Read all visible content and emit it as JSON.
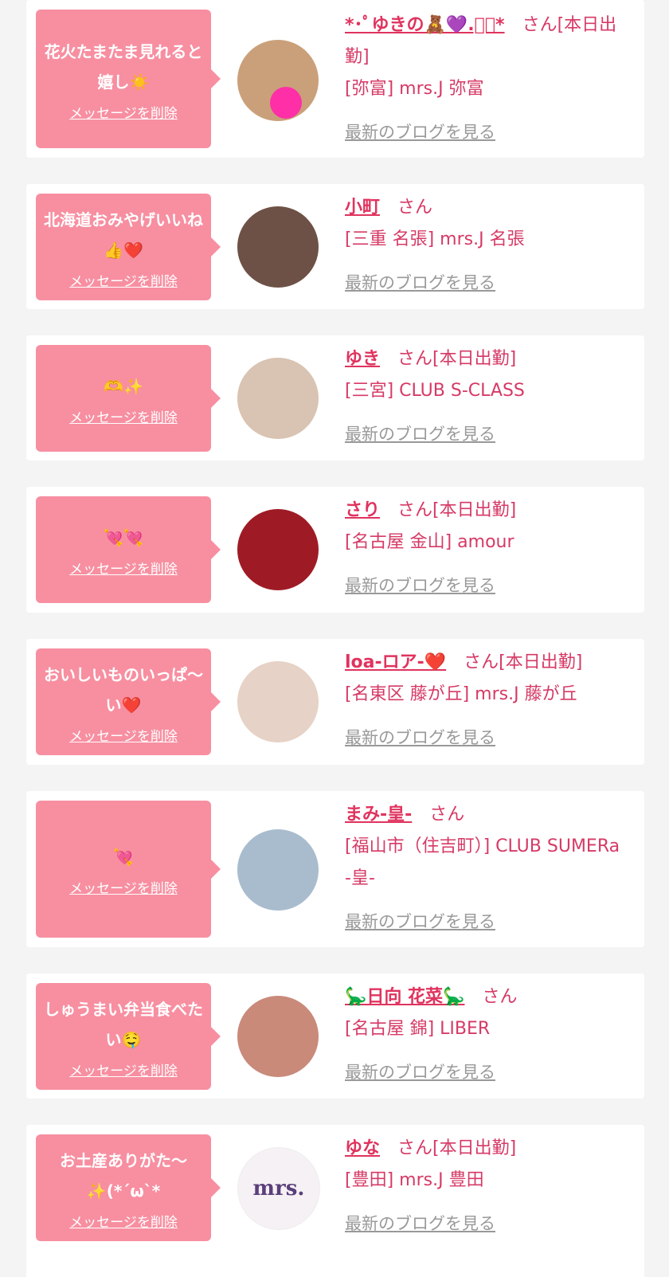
{
  "items": [
    {
      "message": "花火たまたま見れると嬉し☀️",
      "delete_label": "メッセージを削除",
      "name": "*･ﾟゆきの🧸💜.ﾟ･*",
      "honorific": "さん[本日出勤]",
      "shop": "[弥富] mrs.J 弥富",
      "blog_link": "最新のブログを見る",
      "avatar_color": "#caa07a"
    },
    {
      "message": "北海道おみやげいいね👍❤️",
      "delete_label": "メッセージを削除",
      "name": "小町",
      "honorific": "さん",
      "shop": "[三重 名張] mrs.J 名張",
      "blog_link": "最新のブログを見る",
      "avatar_color": "#6e5146"
    },
    {
      "message": "🫶✨",
      "delete_label": "メッセージを削除",
      "name": "ゆき",
      "honorific": "さん[本日出勤]",
      "shop": "[三宮] CLUB S-CLASS",
      "blog_link": "最新のブログを見る",
      "avatar_color": "#d9c3b2"
    },
    {
      "message": "💘💘",
      "delete_label": "メッセージを削除",
      "name": "さり",
      "honorific": "さん[本日出勤]",
      "shop": "[名古屋 金山] amour",
      "blog_link": "最新のブログを見る",
      "avatar_color": "#9e1b25"
    },
    {
      "message": "おいしいものいっぱ〜い❤️",
      "delete_label": "メッセージを削除",
      "name": "loa-ロア-❤️",
      "honorific": "さん[本日出勤]",
      "shop": "[名東区 藤が丘] mrs.J 藤が丘",
      "blog_link": "最新のブログを見る",
      "avatar_color": "#e6d2c6"
    },
    {
      "message": "💘",
      "delete_label": "メッセージを削除",
      "name": "まみ-皇-",
      "honorific": "さん",
      "shop": "[福山市（住吉町）] CLUB SUMERa -皇-",
      "blog_link": "最新のブログを見る",
      "avatar_color": "#a9bccd"
    },
    {
      "message": "しゅうまい弁当食べたい🤤",
      "delete_label": "メッセージを削除",
      "name": "🦕日向 花菜🦕",
      "honorific": "さん",
      "shop": "[名古屋 錦] LIBER",
      "blog_link": "最新のブログを見る",
      "avatar_color": "#c98a7a"
    },
    {
      "message": "お土産ありがた〜✨(*´ω`*",
      "delete_label": "メッセージを削除",
      "name": "ゆな",
      "honorific": "さん[本日出勤]",
      "shop": "[豊田] mrs.J 豊田",
      "blog_link": "最新のブログを見る",
      "avatar_color": "#f5f1f4",
      "avatar_text": "mrs."
    }
  ]
}
